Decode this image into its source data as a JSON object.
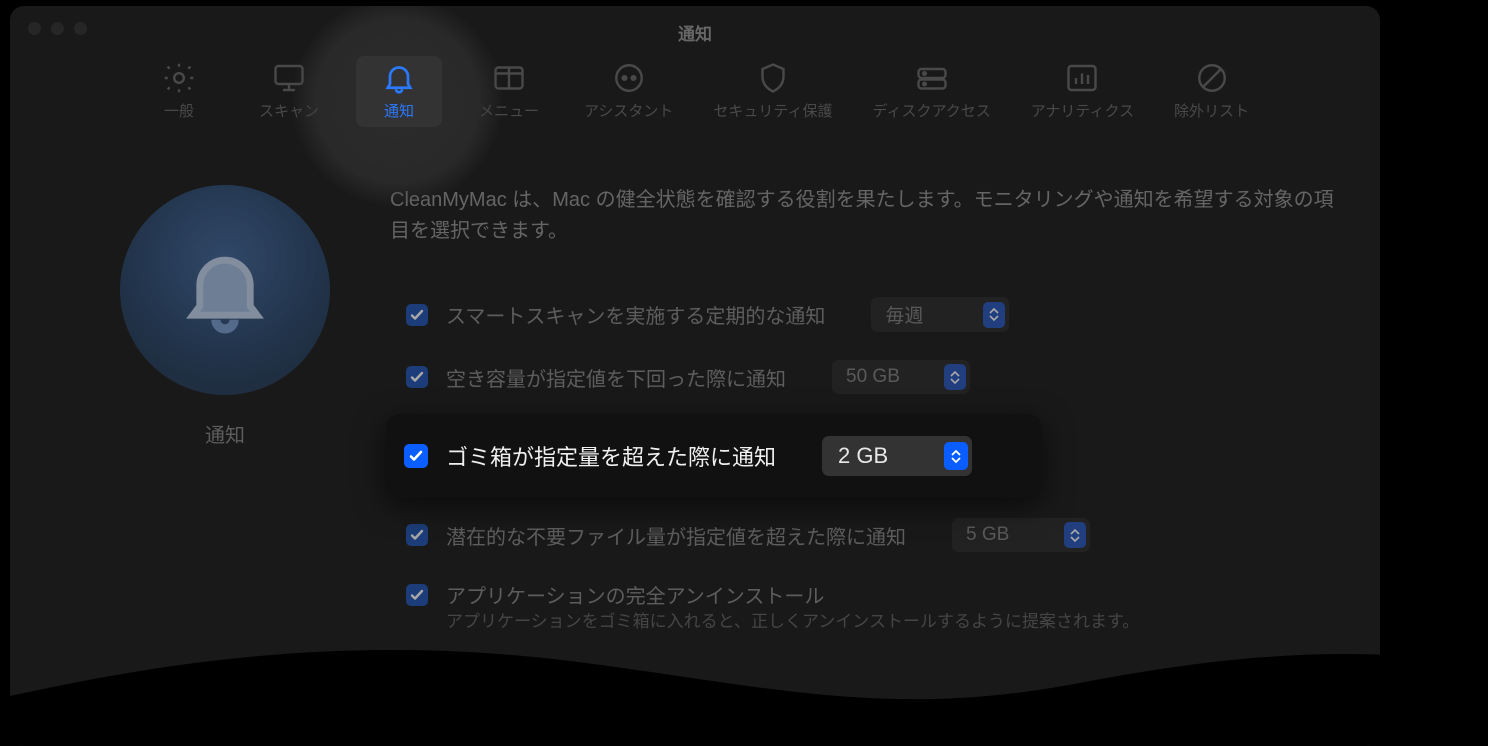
{
  "window": {
    "title": "通知"
  },
  "toolbar": {
    "items": [
      {
        "label": "一般"
      },
      {
        "label": "スキャン"
      },
      {
        "label": "通知"
      },
      {
        "label": "メニュー"
      },
      {
        "label": "アシスタント"
      },
      {
        "label": "セキュリティ保護"
      },
      {
        "label": "ディスクアクセス"
      },
      {
        "label": "アナリティクス"
      },
      {
        "label": "除外リスト"
      }
    ],
    "selected_index": 2
  },
  "side": {
    "caption": "通知"
  },
  "description": "CleanMyMac は、Mac の健全状態を確認する役割を果たします。モニタリングや通知を希望する対象の項目を選択できます。",
  "options": {
    "smart_scan": {
      "checked": true,
      "label": "スマートスキャンを実施する定期的な通知",
      "value": "毎週"
    },
    "low_space": {
      "checked": true,
      "label": "空き容量が指定値を下回った際に通知",
      "value": "50 GB"
    },
    "trash": {
      "checked": true,
      "label": "ゴミ箱が指定量を超えた際に通知",
      "value": "2 GB"
    },
    "junk": {
      "checked": true,
      "label": "潜在的な不要ファイル量が指定値を超えた際に通知",
      "value": "5 GB"
    },
    "uninstall": {
      "checked": true,
      "label": "アプリケーションの完全アンインストール",
      "sub": "アプリケーションをゴミ箱に入れると、正しくアンインストールするように提案されます。"
    }
  }
}
